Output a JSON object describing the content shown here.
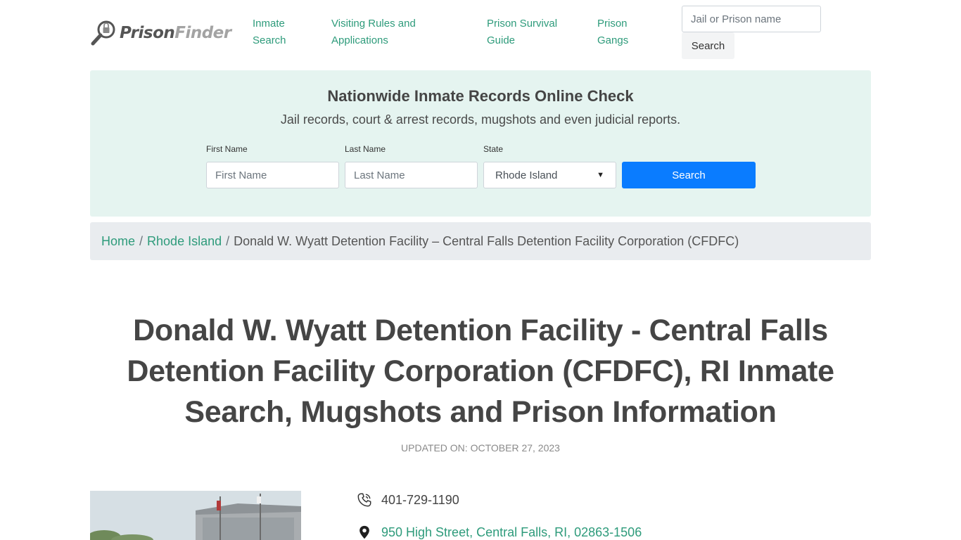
{
  "header": {
    "logo": {
      "part1": "Prison",
      "part2": "Finder"
    },
    "nav": [
      {
        "label": "Inmate Search"
      },
      {
        "label": "Visiting Rules and Applications"
      },
      {
        "label": "Prison Survival Guide"
      },
      {
        "label": "Prison Gangs"
      }
    ],
    "search": {
      "placeholder": "Jail or Prison name",
      "button": "Search"
    }
  },
  "records": {
    "title": "Nationwide Inmate Records Online Check",
    "subtitle": "Jail records, court & arrest records, mugshots and even judicial reports.",
    "first_name": {
      "label": "First Name",
      "placeholder": "First Name"
    },
    "last_name": {
      "label": "Last Name",
      "placeholder": "Last Name"
    },
    "state": {
      "label": "State",
      "selected": "Rhode Island"
    },
    "button": "Search"
  },
  "breadcrumb": {
    "home": "Home",
    "separator": "/",
    "state": "Rhode Island",
    "current": "Donald W. Wyatt Detention Facility – Central Falls Detention Facility Corporation (CFDFC)"
  },
  "page": {
    "title": "Donald W. Wyatt Detention Facility - Central Falls Detention Facility Corporation (CFDFC), RI Inmate Search, Mugshots and Prison Information",
    "updated": "UPDATED ON: OCTOBER 27, 2023"
  },
  "facility": {
    "phone": "401-729-1190",
    "address": "950 High Street, Central Falls, RI, 02863-1506",
    "phone_icon": "phone-icon",
    "address_icon": "map-pin-icon"
  },
  "colors": {
    "accent_green": "#2e9b7b",
    "panel_bg": "#e5f4f0",
    "primary_button": "#0a7cff",
    "breadcrumb_bg": "#e9ecef"
  }
}
